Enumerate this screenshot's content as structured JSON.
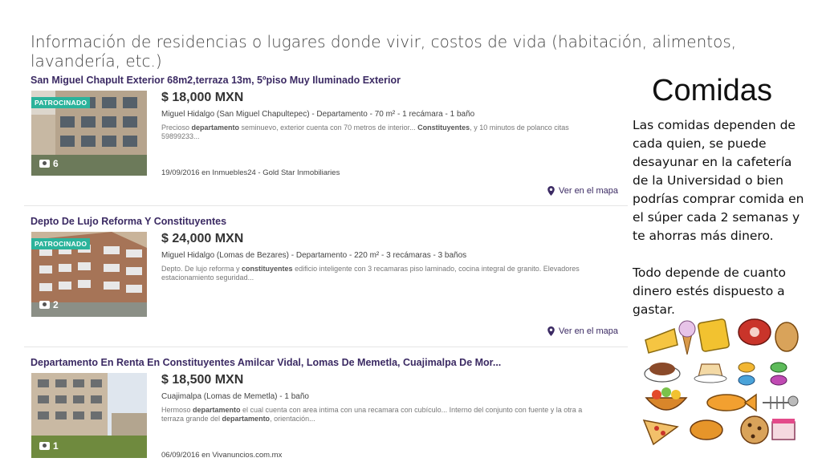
{
  "slide": {
    "title": "Información de residencias o lugares donde vivir, costos de vida (habitación, alimentos, lavandería, etc.)"
  },
  "listings": [
    {
      "title": "San Miguel Chapult Exterior 68m2,terraza 13m, 5ºpiso Muy Iluminado Exterior",
      "badge": "PATROCINADO",
      "photo_count": "6",
      "price": "$ 18,000 MXN",
      "subtitle": "Miguel Hidalgo (San Miguel Chapultepec) - Departamento - 70 m² - 1 recámara - 1 baño",
      "desc_parts": [
        "Precioso ",
        "departamento",
        " seminuevo, exterior cuenta con 70 metros de interior... ",
        "Constituyentes",
        ", y 10 minutos de polanco citas 59899233..."
      ],
      "published": "19/09/2016 en Inmuebles24 - Gold Star Inmobiliaries",
      "map_link": "Ver en el mapa"
    },
    {
      "title": "Depto De Lujo Reforma Y Constituyentes",
      "badge": "PATROCINADO",
      "photo_count": "2",
      "price": "$ 24,000 MXN",
      "subtitle": "Miguel Hidalgo (Lomas de Bezares) - Departamento - 220 m² - 3 recámaras - 3 baños",
      "desc_parts": [
        "Depto. De lujo reforma y ",
        "constituyentes",
        " edificio inteligente con 3 recamaras piso laminado, cocina integral de granito. Elevadores estacionamiento seguridad..."
      ],
      "published": "",
      "map_link": "Ver en el mapa"
    },
    {
      "title": "Departamento En Renta En Constituyentes Amilcar Vidal, Lomas De Memetla, Cuajimalpa De Mor...",
      "badge": "",
      "photo_count": "1",
      "price": "$ 18,500 MXN",
      "subtitle": "Cuajimalpa (Lomas de Memetla) - 1 baño",
      "desc_parts": [
        "Hermoso ",
        "departamento",
        " el cual cuenta con area intima con una recamara con cubículo... Interno del conjunto con fuente y la otra a terraza grande del ",
        "departamento",
        ", orientación..."
      ],
      "published": "06/09/2016 en Vivanuncios.com.mx",
      "map_link": ""
    }
  ],
  "side": {
    "heading": "Comidas",
    "paragraph1": "Las comidas dependen de cada quien, se puede desayunar en la cafetería de la Universidad o bien podrías comprar comida en el súper cada 2 semanas y te ahorras más dinero.",
    "paragraph2": "Todo depende de cuanto dinero estés dispuesto a gastar."
  },
  "colors": {
    "listing_title": "#3b2a63",
    "badge": "#2bb39b",
    "text": "#333333"
  }
}
